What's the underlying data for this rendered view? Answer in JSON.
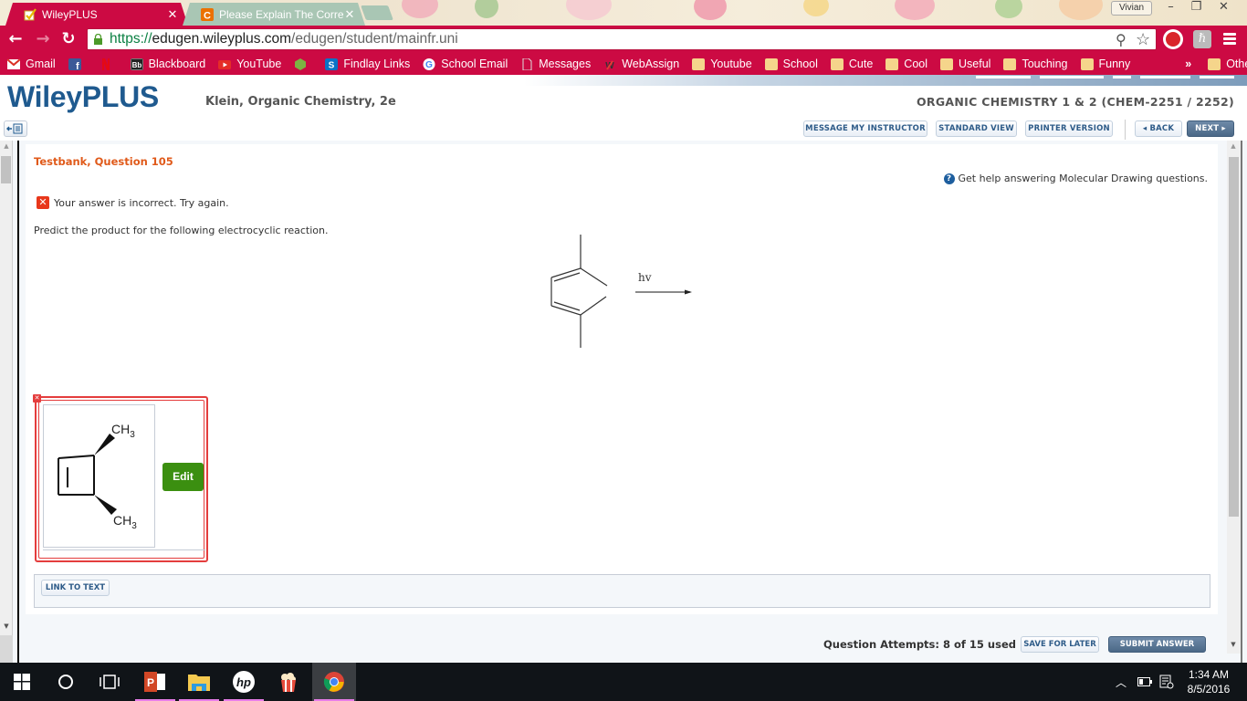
{
  "browser": {
    "tabs": [
      {
        "title": "WileyPLUS",
        "active": true,
        "icon": "wileyplus-favicon"
      },
      {
        "title": "Please Explain The Correc",
        "active": false,
        "icon": "chegg-favicon"
      }
    ],
    "profile_name": "Vivian",
    "url": {
      "scheme": "https://",
      "host": "edugen.wileyplus.com",
      "path": "/edugen/student/mainfr.uni"
    },
    "bookmarks": [
      {
        "label": "Gmail",
        "icon": "gmail-icon"
      },
      {
        "label": "",
        "icon": "facebook-icon"
      },
      {
        "label": "",
        "icon": "netflix-icon"
      },
      {
        "label": "Blackboard",
        "icon": "blackboard-icon"
      },
      {
        "label": "YouTube",
        "icon": "youtube-icon"
      },
      {
        "label": "",
        "icon": "hexagon-app-icon"
      },
      {
        "label": "Findlay Links",
        "icon": "sharepoint-icon"
      },
      {
        "label": "School Email",
        "icon": "google-icon"
      },
      {
        "label": "Messages",
        "icon": "page-icon"
      },
      {
        "label": "WebAssign",
        "icon": "webassign-icon"
      },
      {
        "label": "Youtube",
        "icon": "folder-icon"
      },
      {
        "label": "School",
        "icon": "folder-icon"
      },
      {
        "label": "Cute",
        "icon": "folder-icon"
      },
      {
        "label": "Cool",
        "icon": "folder-icon"
      },
      {
        "label": "Useful",
        "icon": "folder-icon"
      },
      {
        "label": "Touching",
        "icon": "folder-icon"
      },
      {
        "label": "Funny",
        "icon": "folder-icon"
      }
    ],
    "bookmarks_overflow": "»",
    "other_bookmarks": "Other bookmarks"
  },
  "header": {
    "logo": "WileyPLUS",
    "book": "Klein, Organic Chemistry, 2e",
    "course": "ORGANIC CHEMISTRY 1 & 2 (CHEM-2251 / 2252)",
    "buttons": {
      "message_instructor": "MESSAGE MY INSTRUCTOR",
      "standard_view": "STANDARD VIEW",
      "printer_version": "PRINTER VERSION",
      "back": "◂ BACK",
      "next": "NEXT ▸"
    }
  },
  "question": {
    "title": "Testbank, Question 105",
    "help_text": "Get help answering Molecular Drawing questions.",
    "feedback": "Your answer is incorrect.  Try again.",
    "prompt": "Predict the product for the following electrocyclic reaction.",
    "reaction_condition": "hv",
    "answer_labels": {
      "top": "CH",
      "top_sub": "3",
      "bottom": "CH",
      "bottom_sub": "3"
    },
    "edit_button": "Edit",
    "link_to_text": "LINK TO TEXT"
  },
  "footer": {
    "attempts": "Question Attempts: 8 of 15 used",
    "save_for_later": "SAVE FOR LATER",
    "submit": "SUBMIT ANSWER"
  },
  "taskbar": {
    "time": "1:34 AM",
    "date": "8/5/2016",
    "apps": [
      "start",
      "cortana",
      "task-view",
      "powerpoint",
      "file-explorer",
      "hp",
      "popcorn-time",
      "chrome"
    ]
  },
  "colors": {
    "chrome_accent": "#cc0a43",
    "wiley_blue": "#1f5a8f",
    "question_title": "#e05a1a",
    "error_red": "#e43d3d",
    "edit_green": "#3b8f10",
    "button_dark": "#4b6887"
  }
}
